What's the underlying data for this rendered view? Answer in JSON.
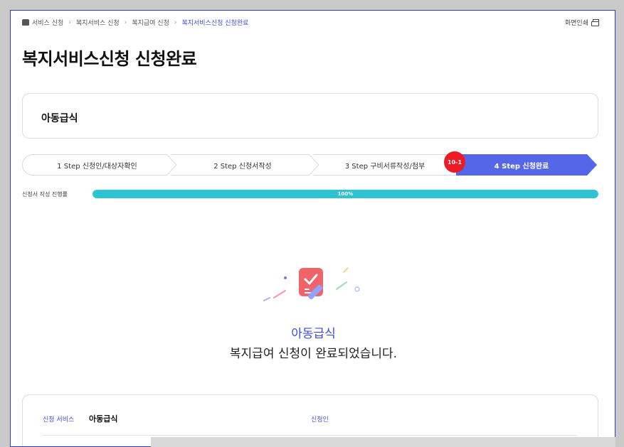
{
  "breadcrumb": {
    "items": [
      "서비스 신청",
      "복지서비스 신청",
      "복지급여 신청",
      "복지서비스신청 신청완료"
    ],
    "home_icon": "home-icon"
  },
  "header": {
    "print_label": "화면인쇄",
    "print_icon": "printer-icon",
    "title": "복지서비스신청 신청완료"
  },
  "service": {
    "name": "아동급식"
  },
  "steps": [
    {
      "label": "1 Step 신청인/대상자확인"
    },
    {
      "label": "2 Step 신청서작성"
    },
    {
      "label": "3 Step 구비서류작성/첨부"
    },
    {
      "label": "4 Step 신청완료"
    }
  ],
  "step_badge": "10-1",
  "progress": {
    "label": "신청서 작성 진행률",
    "percent_text": "100%",
    "value": 1.0
  },
  "completion": {
    "service_name": "아동급식",
    "message": "복지급여 신청이 완료되었습니다.",
    "icon": "document-check-icon"
  },
  "summary": {
    "service_label": "신청 서비스",
    "service_value": "아동급식",
    "applicant_label": "신청인"
  },
  "colors": {
    "accent": "#5566e8",
    "progress": "#2ec3d3",
    "badge": "#ee1b24",
    "link": "#3d4fd6"
  }
}
